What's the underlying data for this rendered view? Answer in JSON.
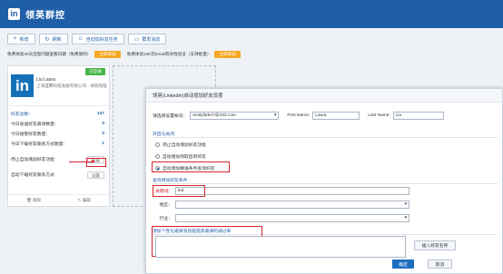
{
  "app": {
    "title": "领英群控",
    "logo": "in"
  },
  "toolbar": {
    "buttons": [
      {
        "label": "新增",
        "icon": "plus-icon"
      },
      {
        "label": "刷新",
        "icon": "refresh-icon"
      },
      {
        "label": "自动加好友任务",
        "icon": "user-add-icon"
      },
      {
        "label": "群发消息",
        "icon": "message-icon"
      }
    ]
  },
  "promo": {
    "text1": "免费体验30天出现问题查看日期（免费限时）",
    "btn1": "立即体验",
    "text2": "免费体验100次Email有效性验证（支持批量）",
    "btn2": "立即体验"
  },
  "card": {
    "badge": "已登录",
    "avatar": "in",
    "name": "Liu Laura",
    "company": "上海盛腾科技发展有限公司 · 采购经理",
    "stats": [
      {
        "label": "好友总数：",
        "value": "147"
      },
      {
        "label": "今日发送好友邀请数量：",
        "value": "0"
      },
      {
        "label": "今日接受好友数量：",
        "value": "0"
      },
      {
        "label": "今日下载好友联系方式数量：",
        "value": "1"
      }
    ],
    "auto_add_label": "停止自动增加好友功能",
    "auto_add_btn": "设置",
    "auto_dl_label": "自动下载好友联系方式",
    "auto_dl_btn": "设置",
    "delete_label": "删除",
    "edit_label": "编辑"
  },
  "dialog": {
    "title": "领英(Linkedin)自动增加好友设置",
    "email_label": "请选择设置帐号：",
    "email_value": "emilylt2647@163.com",
    "first_name_label": "First Name:",
    "first_name_value": "Laura",
    "last_name_label": "Last Name:",
    "last_name_value": "Liu",
    "section1": "开启与关闭",
    "radios": [
      {
        "label": "停止自动增加好友功能",
        "selected": false
      },
      {
        "label": "自动增加领取后的好友",
        "selected": false
      },
      {
        "label": "自动增加精准条件查询好友",
        "selected": true
      }
    ],
    "section2": "查询增加好友条件",
    "keyword_label": "关键词：",
    "keyword_value": "led",
    "region_label": "地区：",
    "region_value": "",
    "industry_label": "行业：",
    "industry_value": "",
    "section3": "添加个性化邀请消息能提高邀请的通过率",
    "insert_btn": "插入好友名称",
    "ok_btn": "确定",
    "cancel_btn": "取消"
  },
  "colors": {
    "brand": "#1f5fa8",
    "accent": "#f5a623",
    "highlight": "#d9232d",
    "online": "#44b549"
  }
}
